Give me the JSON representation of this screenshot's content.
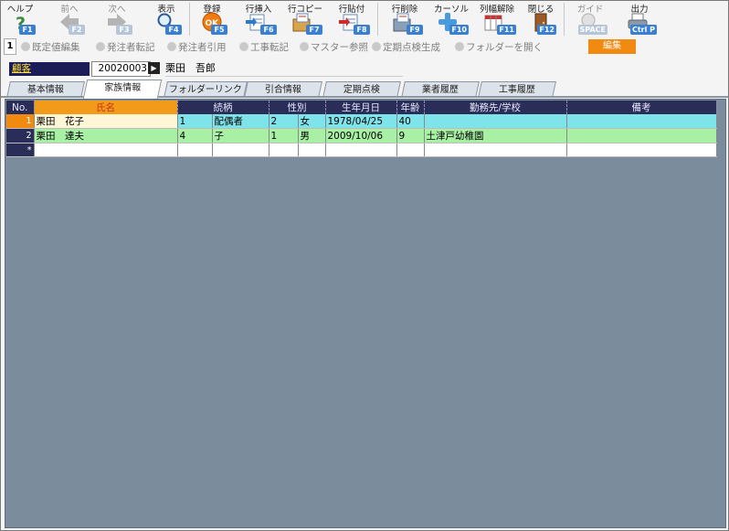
{
  "toolbar": {
    "buttons": [
      {
        "label": "ヘルプ",
        "key": "F1",
        "icon": "help-icon",
        "enabled": true
      },
      {
        "label": "前へ",
        "key": "F2",
        "icon": "arrow-left-icon",
        "enabled": false
      },
      {
        "label": "次へ",
        "key": "F3",
        "icon": "arrow-right-icon",
        "enabled": false
      },
      {
        "label": "表示",
        "key": "F4",
        "icon": "magnifier-icon",
        "enabled": true
      },
      {
        "label": "登録",
        "key": "F5",
        "icon": "ok-icon",
        "enabled": true
      },
      {
        "label": "行挿入",
        "key": "F6",
        "icon": "row-insert-icon",
        "enabled": true
      },
      {
        "label": "行コピー",
        "key": "F7",
        "icon": "row-copy-icon",
        "enabled": true
      },
      {
        "label": "行貼付",
        "key": "F8",
        "icon": "row-paste-icon",
        "enabled": true
      },
      {
        "label": "行削除",
        "key": "F9",
        "icon": "row-delete-icon",
        "enabled": true
      },
      {
        "label": "カーソル",
        "key": "F10",
        "icon": "cursor-cross-icon",
        "enabled": true
      },
      {
        "label": "列幅解除",
        "key": "F11",
        "icon": "column-width-icon",
        "enabled": true
      },
      {
        "label": "閉じる",
        "key": "F12",
        "icon": "door-close-icon",
        "enabled": true
      },
      {
        "label": "ガイド",
        "key": "SPACE",
        "icon": "lightbulb-icon",
        "enabled": false
      },
      {
        "label": "出力",
        "key": "Ctrl P",
        "icon": "print-icon",
        "enabled": true
      }
    ]
  },
  "secondary_toolbar": {
    "page_number": "1",
    "items": [
      "既定値編集",
      "発注者転記",
      "発注者引用",
      "工事転記",
      "マスター参照",
      "定期点検生成",
      "フォルダーを開く"
    ],
    "mode_badge": "編集"
  },
  "customer": {
    "label": "顧客",
    "code": "20020003",
    "go_symbol": "▶",
    "name": "栗田　吾郎"
  },
  "tabs": [
    "基本情報",
    "家族情報",
    "フォルダーリンク",
    "引合情報",
    "定期点検",
    "業者履歴",
    "工事履歴"
  ],
  "active_tab": 1,
  "grid": {
    "headers": [
      "No.",
      "氏名",
      "続柄",
      "",
      "性別",
      "",
      "生年月日",
      "年齢",
      "勤務先/学校",
      "備考"
    ],
    "rows": [
      {
        "no": "1",
        "name": "栗田　花子",
        "rel_code": "1",
        "rel": "配偶者",
        "sex_code": "2",
        "sex": "女",
        "birth": "1978/04/25",
        "age": "40",
        "work": "",
        "note": ""
      },
      {
        "no": "2",
        "name": "栗田　達夫",
        "rel_code": "4",
        "rel": "子",
        "sex_code": "1",
        "sex": "男",
        "birth": "2009/10/06",
        "age": "9",
        "work": "土津戸幼稚園",
        "note": ""
      },
      {
        "no": "*",
        "name": "",
        "rel_code": "",
        "rel": "",
        "sex_code": "",
        "sex": "",
        "birth": "",
        "age": "",
        "work": "",
        "note": ""
      }
    ]
  },
  "colors": {
    "accent": "#f08a10",
    "header": "#2a2d57",
    "row_selected": "#7fe3ea",
    "row_alt": "#a8f0a4",
    "background": "#7b8c9c"
  }
}
